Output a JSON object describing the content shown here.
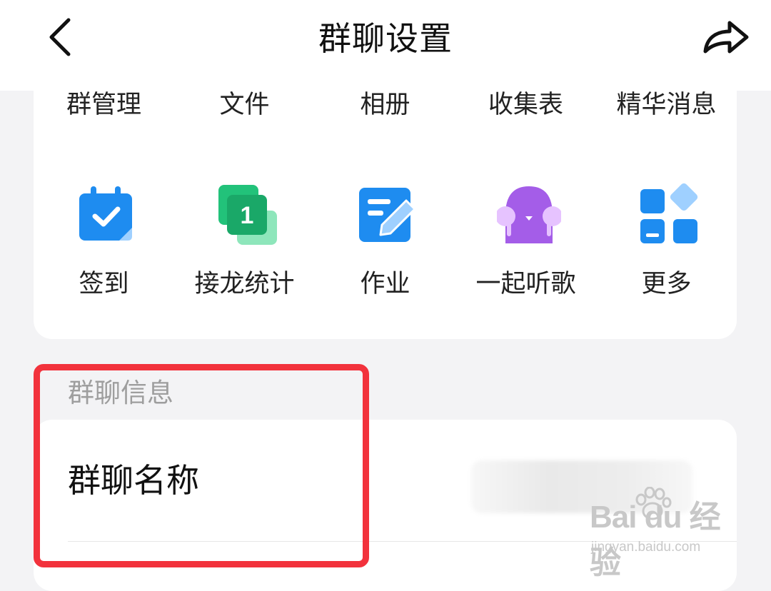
{
  "header": {
    "title": "群聊设置",
    "back_icon": "chevron-left-icon",
    "share_icon": "share-arrow-icon"
  },
  "function_row": [
    "群管理",
    "文件",
    "相册",
    "收集表",
    "精华消息"
  ],
  "tools": [
    {
      "label": "签到",
      "icon": "calendar-check-icon",
      "color": "#1e8cf0"
    },
    {
      "label": "接龙统计",
      "icon": "relay-stats-icon",
      "color": "#22c27a"
    },
    {
      "label": "作业",
      "icon": "homework-edit-icon",
      "color": "#1e8cf0"
    },
    {
      "label": "一起听歌",
      "icon": "listen-together-icon",
      "color": "#a45de8"
    },
    {
      "label": "更多",
      "icon": "more-grid-icon",
      "color": "#1e8cf0"
    }
  ],
  "group_info": {
    "section_title": "群聊信息",
    "name_label": "群聊名称"
  },
  "highlight_color": "#f2323c",
  "watermark": {
    "logo": "Bai  du 经验",
    "url": "jingyan.baidu.com"
  }
}
